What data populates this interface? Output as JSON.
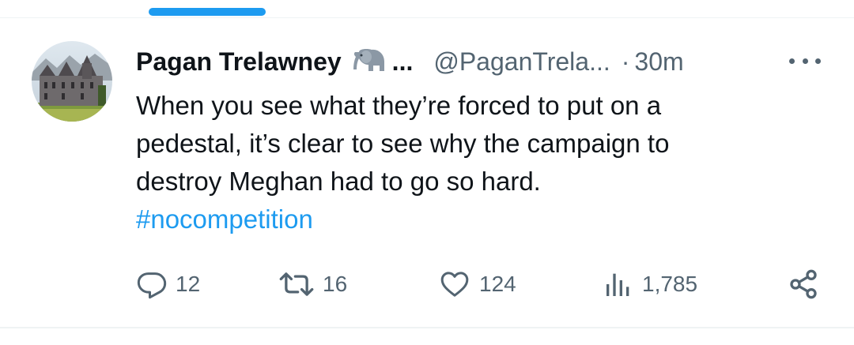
{
  "tweet": {
    "author_name": "Pagan Trelawney",
    "author_emoji": "elephant-icon",
    "name_truncation": "...",
    "handle": "@PaganTrela...",
    "separator": "·",
    "time": "30m",
    "text_lines": [
      "When you see what they’re forced to put on a",
      "pedestal, it’s clear to see why the campaign to",
      "destroy Meghan had to go so hard."
    ],
    "hashtag": "#nocompetition"
  },
  "actions": {
    "replies": "12",
    "reposts": "16",
    "likes": "124",
    "views": "1,785"
  },
  "colors": {
    "accent": "#1d9bf0",
    "text": "#0f1419",
    "muted": "#536471",
    "divider": "#eff3f4"
  },
  "icons": {
    "reply": "reply-icon",
    "repost": "repost-icon",
    "like": "heart-icon",
    "views": "views-icon",
    "share": "share-icon",
    "more": "more-icon"
  }
}
